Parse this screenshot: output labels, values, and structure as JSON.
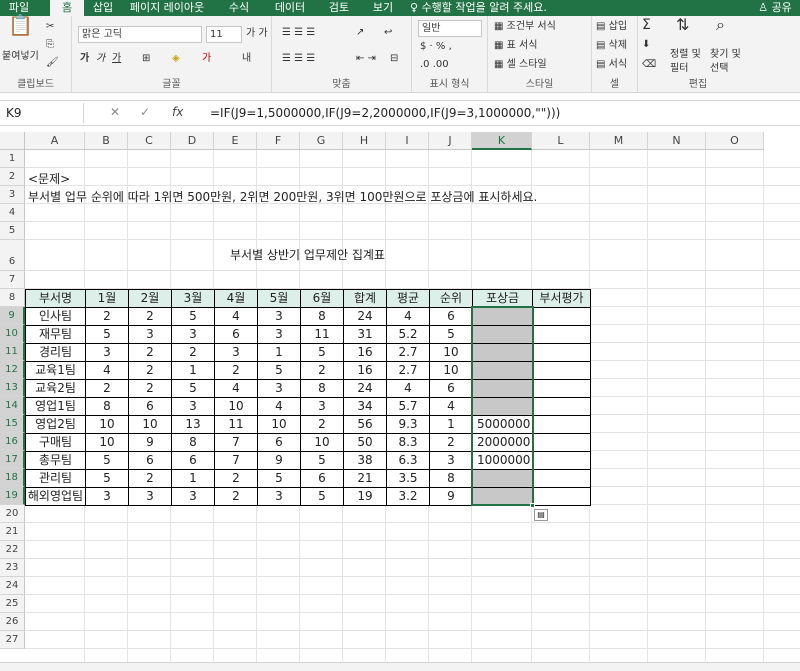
{
  "tabs": {
    "file": "파일",
    "home": "홈",
    "insert": "삽입",
    "layout": "페이지 레이아웃",
    "formulas": "수식",
    "data": "데이터",
    "review": "검토",
    "view": "보기",
    "search": "수행할 작업을 알려 주세요.",
    "share": "공유"
  },
  "ribbon": {
    "paste": "붙여넣기",
    "clipboard": "클립보드",
    "font_name": "맑은 고딕",
    "font_size": "11",
    "font_group": "글꼴",
    "align_group": "맞춤",
    "num_format": "일반",
    "num_group": "표시 형식",
    "cond_format": "조건부 서식",
    "table_format": "표 서식",
    "cell_style": "셀 스타일",
    "style_group": "스타일",
    "insert": "삽입",
    "delete": "삭제",
    "format": "서식",
    "cell_group": "셀",
    "sort": "정렬 및",
    "sort2": "필터",
    "find": "찾기 및",
    "find2": "선택",
    "edit_group": "편집"
  },
  "formula_bar": {
    "namebox": "K9",
    "fx": "fx",
    "formula": "=IF(J9=1,5000000,IF(J9=2,2000000,IF(J9=3,1000000,\"\")))"
  },
  "columns": [
    "A",
    "B",
    "C",
    "D",
    "E",
    "F",
    "G",
    "H",
    "I",
    "J",
    "K",
    "L",
    "M",
    "N",
    "O"
  ],
  "rows": [
    "1",
    "2",
    "3",
    "4",
    "5",
    "6",
    "7",
    "8",
    "9",
    "10",
    "11",
    "12",
    "13",
    "14",
    "15",
    "16",
    "17",
    "18",
    "19",
    "20",
    "21",
    "22",
    "23",
    "24",
    "25",
    "26",
    "27"
  ],
  "text": {
    "problem": "<문제>",
    "instruction": "부서별 업무 순위에 따라 1위면 500만원, 2위면 200만원, 3위면 100만원으로 포상금에 표시하세요.",
    "table_title": "부서별 상반기 업무제안 집계표"
  },
  "table": {
    "headers": [
      "부서명",
      "1월",
      "2월",
      "3월",
      "4월",
      "5월",
      "6월",
      "합계",
      "평균",
      "순위",
      "포상금",
      "부서평가"
    ],
    "rows": [
      [
        "인사팀",
        "2",
        "2",
        "5",
        "4",
        "3",
        "8",
        "24",
        "4",
        "6",
        "",
        ""
      ],
      [
        "재무팀",
        "5",
        "3",
        "3",
        "6",
        "3",
        "11",
        "31",
        "5.2",
        "5",
        "",
        ""
      ],
      [
        "경리팀",
        "3",
        "2",
        "2",
        "3",
        "1",
        "5",
        "16",
        "2.7",
        "10",
        "",
        ""
      ],
      [
        "교육1팀",
        "4",
        "2",
        "1",
        "2",
        "5",
        "2",
        "16",
        "2.7",
        "10",
        "",
        ""
      ],
      [
        "교육2팀",
        "2",
        "2",
        "5",
        "4",
        "3",
        "8",
        "24",
        "4",
        "6",
        "",
        ""
      ],
      [
        "영업1팀",
        "8",
        "6",
        "3",
        "10",
        "4",
        "3",
        "34",
        "5.7",
        "4",
        "",
        ""
      ],
      [
        "영업2팀",
        "10",
        "10",
        "13",
        "11",
        "10",
        "2",
        "56",
        "9.3",
        "1",
        "5000000",
        ""
      ],
      [
        "구매팀",
        "10",
        "9",
        "8",
        "7",
        "6",
        "10",
        "50",
        "8.3",
        "2",
        "2000000",
        ""
      ],
      [
        "총무팀",
        "5",
        "6",
        "6",
        "7",
        "9",
        "5",
        "38",
        "6.3",
        "3",
        "1000000",
        ""
      ],
      [
        "관리팀",
        "5",
        "2",
        "1",
        "2",
        "5",
        "6",
        "21",
        "3.5",
        "8",
        "",
        ""
      ],
      [
        "해외영업팀",
        "3",
        "3",
        "3",
        "2",
        "3",
        "5",
        "19",
        "3.2",
        "9",
        "",
        ""
      ]
    ]
  },
  "colors": {
    "accent": "#217346",
    "header_fill": "#dcefe9",
    "empty_fill": "#c8c8c8"
  }
}
